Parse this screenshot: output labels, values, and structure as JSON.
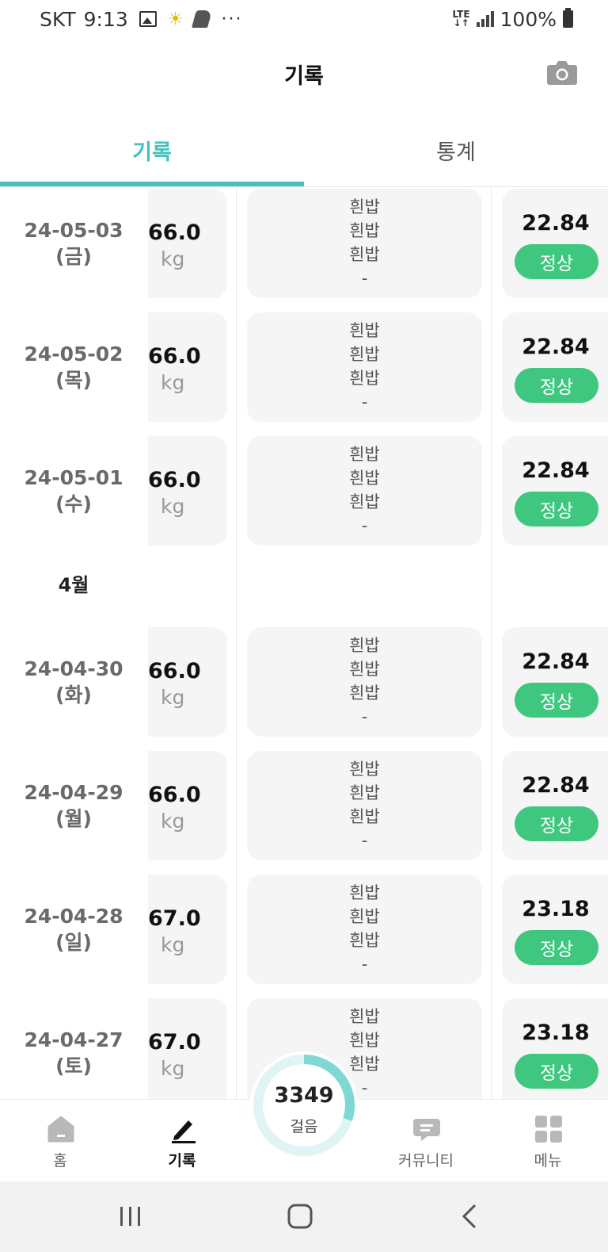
{
  "status_bar": {
    "carrier": "SKT",
    "time": "9:13",
    "icons_left": [
      "image-icon",
      "sun-icon",
      "shoe-icon",
      "more-dots-icon"
    ],
    "network": "LTE",
    "battery": "100%"
  },
  "header": {
    "title": "기록",
    "camera_icon": "camera-icon"
  },
  "tabs": [
    {
      "label": "기록",
      "active": true
    },
    {
      "label": "통계",
      "active": false
    }
  ],
  "colors": {
    "accent": "#45c2bd",
    "normal_badge": "#3fc77f",
    "card_bg": "#f5f5f5"
  },
  "records": [
    {
      "date": "24-05-03",
      "day": "(금)",
      "weight": "66.0",
      "unit": "kg",
      "meals": [
        "흰밥",
        "흰밥",
        "흰밥",
        "-"
      ],
      "bmi": "22.84",
      "status": "정상"
    },
    {
      "date": "24-05-02",
      "day": "(목)",
      "weight": "66.0",
      "unit": "kg",
      "meals": [
        "흰밥",
        "흰밥",
        "흰밥",
        "-"
      ],
      "bmi": "22.84",
      "status": "정상"
    },
    {
      "date": "24-05-01",
      "day": "(수)",
      "weight": "66.0",
      "unit": "kg",
      "meals": [
        "흰밥",
        "흰밥",
        "흰밥",
        "-"
      ],
      "bmi": "22.84",
      "status": "정상"
    }
  ],
  "month_label": "4월",
  "records_april": [
    {
      "date": "24-04-30",
      "day": "(화)",
      "weight": "66.0",
      "unit": "kg",
      "meals": [
        "흰밥",
        "흰밥",
        "흰밥",
        "-"
      ],
      "bmi": "22.84",
      "status": "정상"
    },
    {
      "date": "24-04-29",
      "day": "(월)",
      "weight": "66.0",
      "unit": "kg",
      "meals": [
        "흰밥",
        "흰밥",
        "흰밥",
        "-"
      ],
      "bmi": "22.84",
      "status": "정상"
    },
    {
      "date": "24-04-28",
      "day": "(일)",
      "weight": "67.0",
      "unit": "kg",
      "meals": [
        "흰밥",
        "흰밥",
        "흰밥",
        "-"
      ],
      "bmi": "23.18",
      "status": "정상"
    },
    {
      "date": "24-04-27",
      "day": "(토)",
      "weight": "67.0",
      "unit": "kg",
      "meals": [
        "흰밥",
        "흰밥",
        "흰밥",
        "-"
      ],
      "bmi": "23.18",
      "status": "정상"
    }
  ],
  "steps": {
    "count": "3349",
    "label": "걸음",
    "progress": 0.3
  },
  "bottom_nav": [
    {
      "label": "홈",
      "icon": "home-icon"
    },
    {
      "label": "기록",
      "icon": "pen-icon"
    },
    {
      "label": "커뮤니티",
      "icon": "chat-bubble-icon"
    },
    {
      "label": "메뉴",
      "icon": "grid-menu-icon"
    }
  ],
  "system_nav": [
    "recents-icon",
    "home-button-icon",
    "back-icon"
  ]
}
